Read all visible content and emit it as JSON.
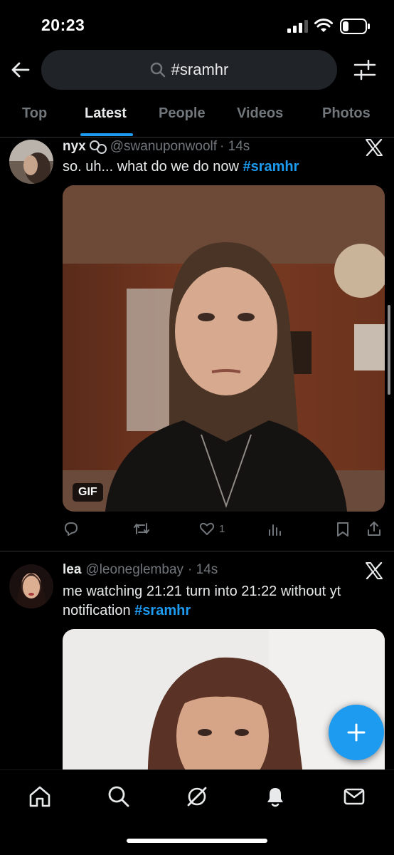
{
  "status_bar": {
    "time": "20:23"
  },
  "search": {
    "query": "#sramhr"
  },
  "tabs": [
    {
      "label": "Top"
    },
    {
      "label": "Latest"
    },
    {
      "label": "People"
    },
    {
      "label": "Videos"
    },
    {
      "label": "Photos"
    }
  ],
  "tweets": [
    {
      "name": "nyx",
      "handle": "@swanuponwoolf",
      "time": "· 14s",
      "text": "so. uh... what do we do now ",
      "hashtag": "#sramhr",
      "media_badge": "GIF",
      "likes": "1"
    },
    {
      "name": "lea",
      "handle": "@leoneglembay",
      "time": "· 14s",
      "text_line1": "me watching 21:21 turn into 21:22 without yt",
      "text_line2": "notification ",
      "hashtag": "#sramhr"
    }
  ],
  "colors": {
    "accent": "#1d9bf0",
    "muted": "#71767b",
    "background": "#000000"
  }
}
